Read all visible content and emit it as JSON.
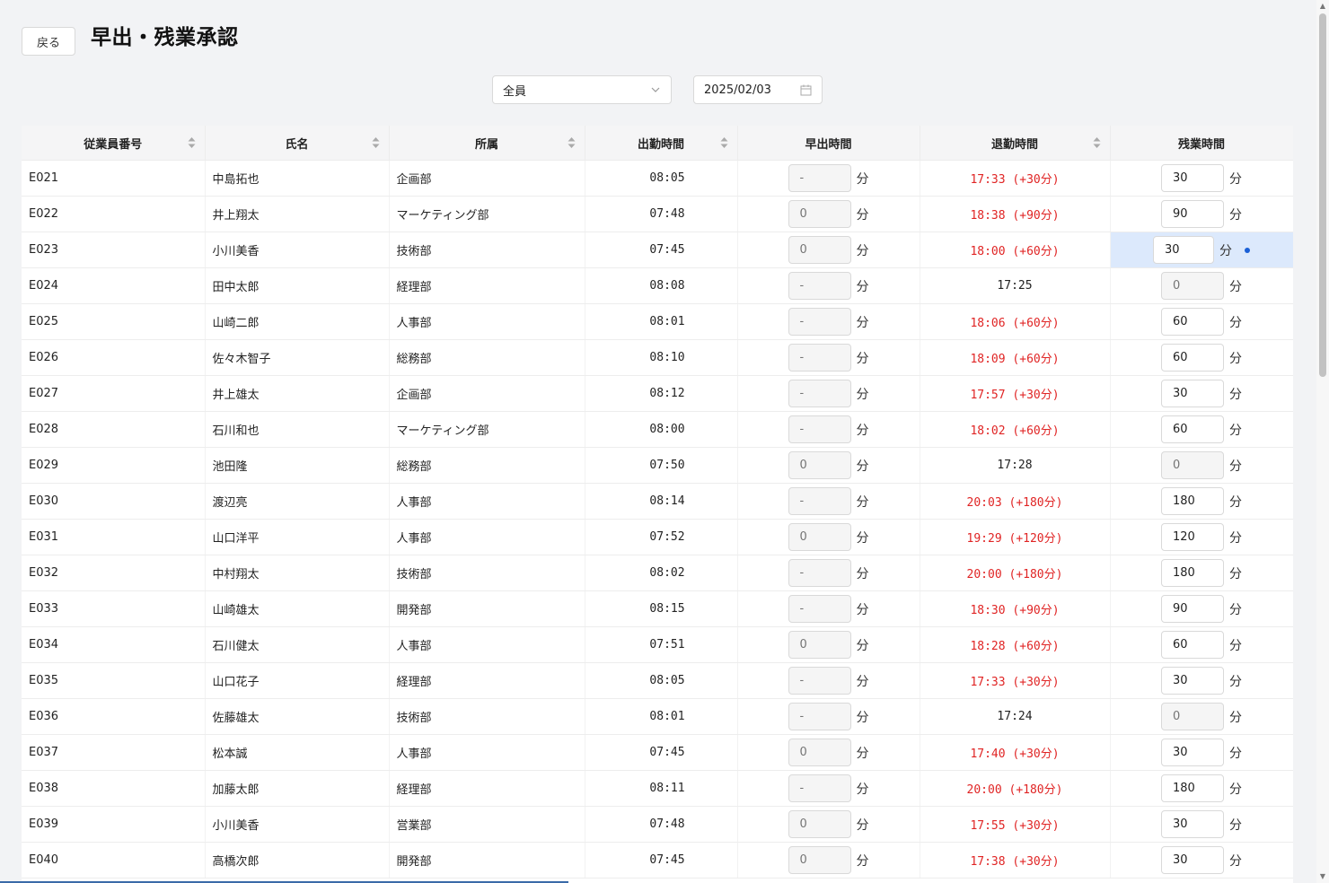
{
  "header": {
    "back_label": "戻る",
    "title": "早出・残業承認"
  },
  "filters": {
    "employee_filter": "全員",
    "date": "2025/02/03"
  },
  "table": {
    "columns": [
      "従業員番号",
      "氏名",
      "所属",
      "出勤時間",
      "早出時間",
      "退勤時間",
      "残業時間"
    ],
    "sortable": [
      true,
      true,
      true,
      true,
      false,
      true,
      false
    ],
    "unit": "分",
    "rows": [
      {
        "id": "E021",
        "name": "中島拓也",
        "dept": "企画部",
        "in": "08:05",
        "early": "-",
        "out": "17:33 (+30分)",
        "overtime": "30",
        "out_flag": true,
        "ot_enabled": true
      },
      {
        "id": "E022",
        "name": "井上翔太",
        "dept": "マーケティング部",
        "in": "07:48",
        "early": "0",
        "out": "18:38 (+90分)",
        "overtime": "90",
        "out_flag": true,
        "ot_enabled": true
      },
      {
        "id": "E023",
        "name": "小川美香",
        "dept": "技術部",
        "in": "07:45",
        "early": "0",
        "out": "18:00 (+60分)",
        "overtime": "30",
        "out_flag": true,
        "ot_enabled": true,
        "highlight": true
      },
      {
        "id": "E024",
        "name": "田中太郎",
        "dept": "経理部",
        "in": "08:08",
        "early": "-",
        "out": "17:25",
        "overtime": "0",
        "out_flag": false,
        "ot_enabled": false
      },
      {
        "id": "E025",
        "name": "山崎二郎",
        "dept": "人事部",
        "in": "08:01",
        "early": "-",
        "out": "18:06 (+60分)",
        "overtime": "60",
        "out_flag": true,
        "ot_enabled": true
      },
      {
        "id": "E026",
        "name": "佐々木智子",
        "dept": "総務部",
        "in": "08:10",
        "early": "-",
        "out": "18:09 (+60分)",
        "overtime": "60",
        "out_flag": true,
        "ot_enabled": true
      },
      {
        "id": "E027",
        "name": "井上雄太",
        "dept": "企画部",
        "in": "08:12",
        "early": "-",
        "out": "17:57 (+30分)",
        "overtime": "30",
        "out_flag": true,
        "ot_enabled": true
      },
      {
        "id": "E028",
        "name": "石川和也",
        "dept": "マーケティング部",
        "in": "08:00",
        "early": "-",
        "out": "18:02 (+60分)",
        "overtime": "60",
        "out_flag": true,
        "ot_enabled": true
      },
      {
        "id": "E029",
        "name": "池田隆",
        "dept": "総務部",
        "in": "07:50",
        "early": "0",
        "out": "17:28",
        "overtime": "0",
        "out_flag": false,
        "ot_enabled": false
      },
      {
        "id": "E030",
        "name": "渡辺亮",
        "dept": "人事部",
        "in": "08:14",
        "early": "-",
        "out": "20:03 (+180分)",
        "overtime": "180",
        "out_flag": true,
        "ot_enabled": true
      },
      {
        "id": "E031",
        "name": "山口洋平",
        "dept": "人事部",
        "in": "07:52",
        "early": "0",
        "out": "19:29 (+120分)",
        "overtime": "120",
        "out_flag": true,
        "ot_enabled": true
      },
      {
        "id": "E032",
        "name": "中村翔太",
        "dept": "技術部",
        "in": "08:02",
        "early": "-",
        "out": "20:00 (+180分)",
        "overtime": "180",
        "out_flag": true,
        "ot_enabled": true
      },
      {
        "id": "E033",
        "name": "山崎雄太",
        "dept": "開発部",
        "in": "08:15",
        "early": "-",
        "out": "18:30 (+90分)",
        "overtime": "90",
        "out_flag": true,
        "ot_enabled": true
      },
      {
        "id": "E034",
        "name": "石川健太",
        "dept": "人事部",
        "in": "07:51",
        "early": "0",
        "out": "18:28 (+60分)",
        "overtime": "60",
        "out_flag": true,
        "ot_enabled": true
      },
      {
        "id": "E035",
        "name": "山口花子",
        "dept": "経理部",
        "in": "08:05",
        "early": "-",
        "out": "17:33 (+30分)",
        "overtime": "30",
        "out_flag": true,
        "ot_enabled": true
      },
      {
        "id": "E036",
        "name": "佐藤雄太",
        "dept": "技術部",
        "in": "08:01",
        "early": "-",
        "out": "17:24",
        "overtime": "0",
        "out_flag": false,
        "ot_enabled": false
      },
      {
        "id": "E037",
        "name": "松本誠",
        "dept": "人事部",
        "in": "07:45",
        "early": "0",
        "out": "17:40 (+30分)",
        "overtime": "30",
        "out_flag": true,
        "ot_enabled": true
      },
      {
        "id": "E038",
        "name": "加藤太郎",
        "dept": "経理部",
        "in": "08:11",
        "early": "-",
        "out": "20:00 (+180分)",
        "overtime": "180",
        "out_flag": true,
        "ot_enabled": true
      },
      {
        "id": "E039",
        "name": "小川美香",
        "dept": "営業部",
        "in": "07:48",
        "early": "0",
        "out": "17:55 (+30分)",
        "overtime": "30",
        "out_flag": true,
        "ot_enabled": true
      },
      {
        "id": "E040",
        "name": "高橋次郎",
        "dept": "開発部",
        "in": "07:45",
        "early": "0",
        "out": "17:38 (+30分)",
        "overtime": "30",
        "out_flag": true,
        "ot_enabled": true
      }
    ]
  },
  "colors": {
    "accent": "#1a5fd6",
    "warning_text": "#e02424",
    "highlight_bg": "#dce9fc"
  }
}
